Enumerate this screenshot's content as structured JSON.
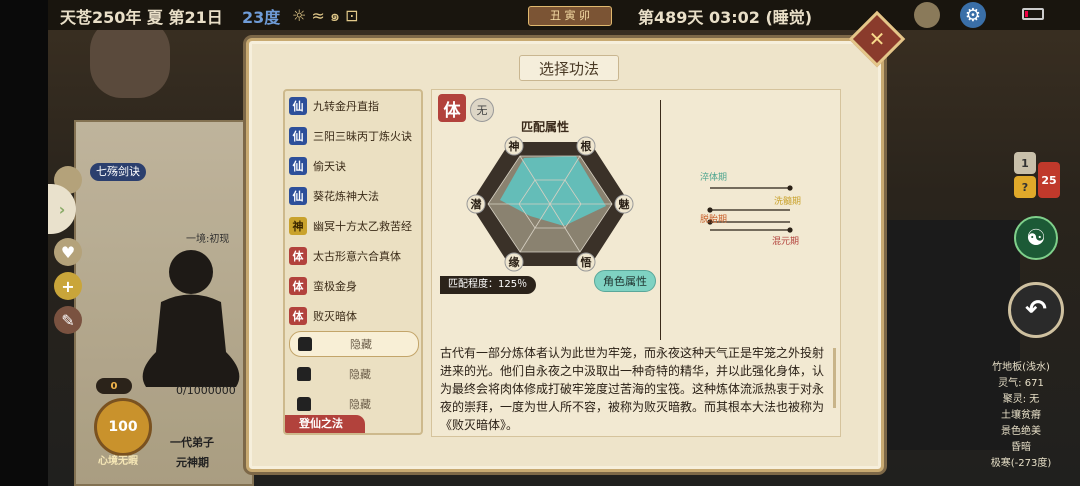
{
  "top_bar": {
    "date": "天苍250年 夏 第21日",
    "temperature": "23度",
    "zodiac": "丑 寅 卯",
    "day_time": "第489天 03:02 (睡觉)"
  },
  "dialog": {
    "title": "选择功法",
    "close_icon": "close-icon"
  },
  "technique_list": {
    "items": [
      {
        "badge": "仙",
        "kind": "xian",
        "name": "九转金丹直指"
      },
      {
        "badge": "仙",
        "kind": "xian",
        "name": "三阳三昧丙丁炼火诀"
      },
      {
        "badge": "仙",
        "kind": "xian",
        "name": "偷天诀"
      },
      {
        "badge": "仙",
        "kind": "xian",
        "name": "葵花炼神大法"
      },
      {
        "badge": "神",
        "kind": "shen",
        "name": "幽冥十方太乙救苦经"
      },
      {
        "badge": "体",
        "kind": "ti",
        "name": "太古形意六合真体"
      },
      {
        "badge": "体",
        "kind": "ti",
        "name": "蛮极金身"
      },
      {
        "badge": "体",
        "kind": "ti",
        "name": "败灭暗体"
      }
    ],
    "hidden_items": [
      "隐藏",
      "隐藏",
      "隐藏"
    ],
    "bottom_tab": "登仙之法"
  },
  "detail": {
    "type_badge": "体",
    "element_badge": "无",
    "attr_title": "匹配属性",
    "radar_labels": [
      "神",
      "根",
      "魅",
      "悟",
      "缘",
      "潜"
    ],
    "match_degree": "匹配程度：125％",
    "role_attr_button": "角色属性",
    "realm_labels": [
      "淬体期",
      "洗髓期",
      "脱胎期",
      "混元期"
    ],
    "description": "古代有一部分炼体者认为此世为牢笼，而永夜这种天气正是牢笼之外投射进来的光。他们自永夜之中汲取出一种奇特的精华，并以此强化身体，认为最终会将肉体修成打破牢笼度过苦海的宝筏。这种炼体流派热衷于对永夜的崇拜，一度为世人所不容，被称为败灭暗教。而其根本大法也被称为《败灭暗体》。"
  },
  "right_info": {
    "lines": [
      "竹地板(浅水)",
      "灵气: 671",
      "聚灵: 无",
      "土壤贫瘠",
      "景色绝美",
      "昏暗",
      "极寒(-273度)"
    ],
    "badge_top": "1",
    "badge_red": "25"
  },
  "left_hud": {
    "realm_label": "一境:初现",
    "skill_label": "七殇剑诀",
    "counter": "0/1000000",
    "disciple": "一代弟子",
    "stage": "元神期",
    "mind_value": "100",
    "mind_label": "心境无暇",
    "count_label": "0"
  },
  "colors": {
    "dialog_bg": "#eee4ca",
    "radar_fill": "#5fc3c0",
    "ti_badge": "#b2423c",
    "xian_badge": "#2d4f9a",
    "shen_badge": "#c9a22c"
  }
}
